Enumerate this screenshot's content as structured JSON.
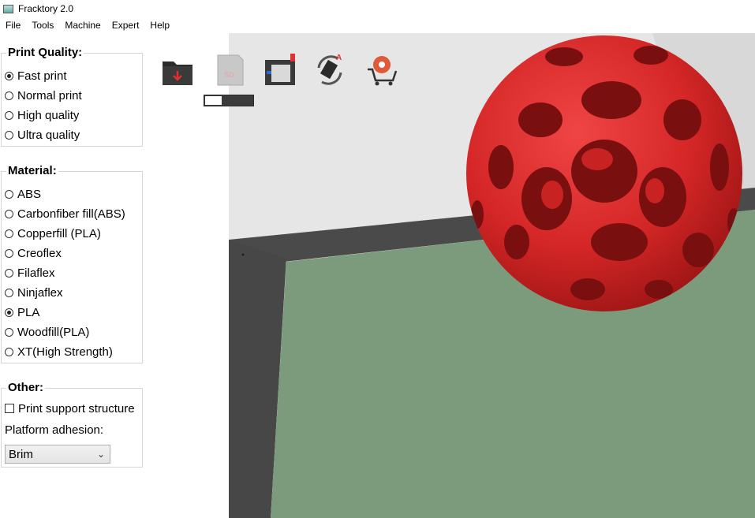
{
  "window": {
    "title": "Fracktory 2.0"
  },
  "menu": [
    "File",
    "Tools",
    "Machine",
    "Expert",
    "Help"
  ],
  "print_quality": {
    "title": "Print Quality:",
    "options": [
      "Fast print",
      "Normal print",
      "High quality",
      "Ultra quality"
    ],
    "selected": "Fast print"
  },
  "material": {
    "title": "Material:",
    "options": [
      "ABS",
      "Carbonfiber fill(ABS)",
      "Copperfill (PLA)",
      "Creoflex",
      "Filaflex",
      "Ninjaflex",
      "PLA",
      "Woodfill(PLA)",
      "XT(High Strength)"
    ],
    "selected": "PLA"
  },
  "other": {
    "title": "Other:",
    "support_label": "Print support structure",
    "support_checked": false,
    "adhesion_label": "Platform adhesion:",
    "adhesion_value": "Brim"
  },
  "toolbar": {
    "icons": [
      "load-folder-icon",
      "sd-card-icon",
      "usb-printer-icon",
      "rotate-auto-icon",
      "filament-cart-icon"
    ],
    "progress_fraction": 0.35
  },
  "colors": {
    "model_red": "#d92b2b",
    "bed_green": "#7c9a7c",
    "frame_dark": "#484848"
  }
}
